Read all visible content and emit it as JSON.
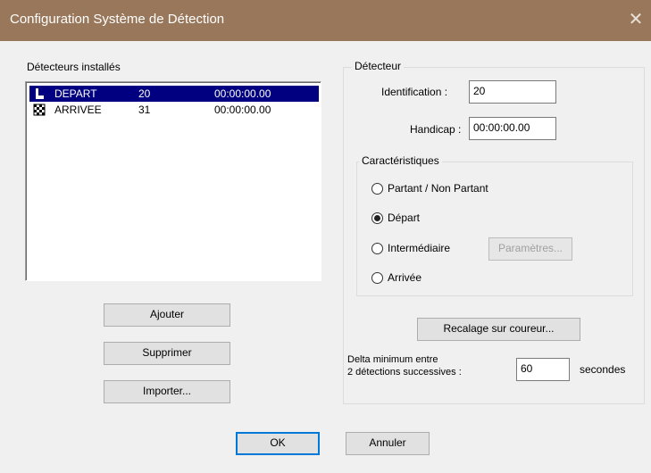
{
  "window": {
    "title": "Configuration Système de Détection",
    "close_glyph": "✕"
  },
  "detectors": {
    "label": "Détecteurs installés",
    "items": [
      {
        "name": "DEPART",
        "id": "20",
        "time": "00:00:00.00",
        "icon": "start-flag-icon",
        "selected": true
      },
      {
        "name": "ARRIVEE",
        "id": "31",
        "time": "00:00:00.00",
        "icon": "checkered-flag-icon",
        "selected": false
      }
    ],
    "buttons": {
      "add": "Ajouter",
      "remove": "Supprimer",
      "import": "Importer..."
    }
  },
  "detector": {
    "legend": "Détecteur",
    "identification_label": "Identification :",
    "identification_value": "20",
    "handicap_label": "Handicap :",
    "handicap_value": "00:00:00.00",
    "characteristics": {
      "legend": "Caractéristiques",
      "options": [
        {
          "label": "Partant / Non Partant",
          "checked": false
        },
        {
          "label": "Départ",
          "checked": true
        },
        {
          "label": "Intermédiaire",
          "checked": false
        },
        {
          "label": "Arrivée",
          "checked": false
        }
      ],
      "params_button": "Paramètres..."
    },
    "resync_button": "Recalage sur coureur...",
    "delta_label_line1": "Delta minimum entre",
    "delta_label_line2": "2 détections successives :",
    "delta_value": "60",
    "delta_unit": "secondes"
  },
  "footer": {
    "ok": "OK",
    "cancel": "Annuler"
  },
  "colors": {
    "titlebar": "#99775a",
    "selection": "#000080",
    "dialog_bg": "#f0f0f0",
    "default_button_border": "#0078d7"
  }
}
